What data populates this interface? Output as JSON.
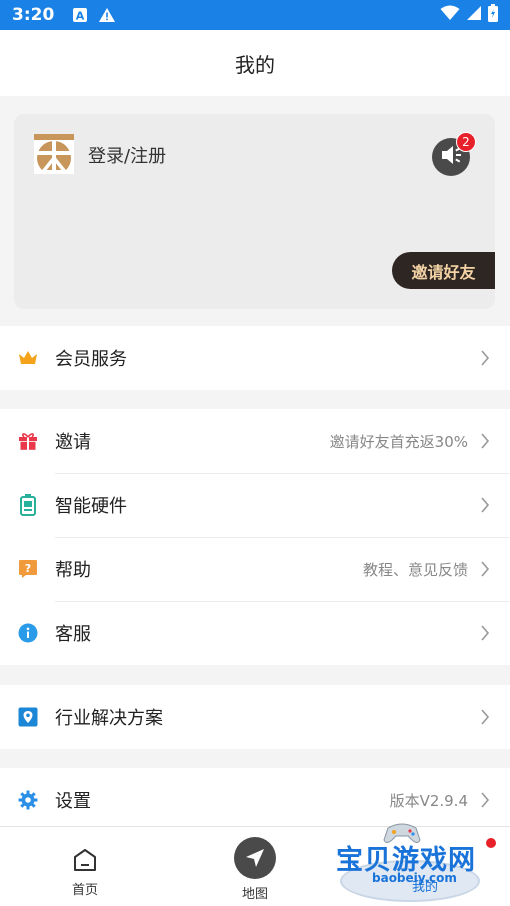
{
  "status_bar": {
    "time": "3:20"
  },
  "header": {
    "title": "我的"
  },
  "profile": {
    "login_label": "登录/注册",
    "message_badge": "2",
    "invite_button": "邀请好友"
  },
  "menu": {
    "vip": {
      "label": "会员服务"
    },
    "invite": {
      "label": "邀请",
      "hint": "邀请好友首充返30%"
    },
    "hardware": {
      "label": "智能硬件"
    },
    "help": {
      "label": "帮助",
      "hint": "教程、意见反馈"
    },
    "service": {
      "label": "客服"
    },
    "solutions": {
      "label": "行业解决方案"
    },
    "settings": {
      "label": "设置",
      "hint": "版本V2.9.4"
    }
  },
  "tabbar": {
    "home": "首页",
    "map": "地图",
    "mine": "我的"
  },
  "watermark": {
    "title": "宝贝游戏网",
    "url": "baobeiy.com"
  },
  "colors": {
    "status_bar": "#1a82e6",
    "crown": "#f4a31b",
    "gift": "#e8384a",
    "hardware": "#27b09a",
    "help": "#f19a3b",
    "info": "#2a9be8",
    "solutions": "#1c87d6",
    "settings": "#2a8fe6",
    "invite_text": "#f3d2a4"
  }
}
